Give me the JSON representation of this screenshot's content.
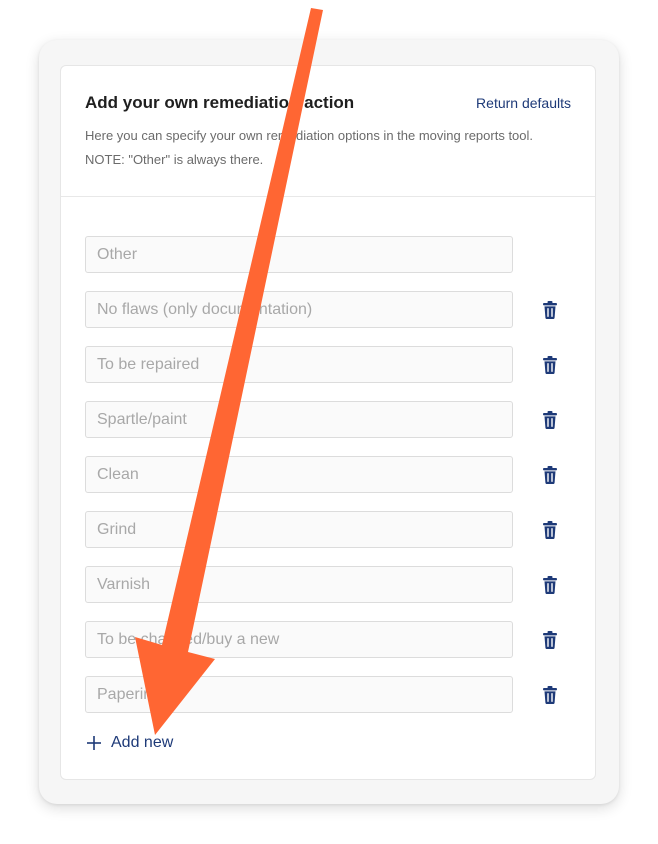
{
  "panel": {
    "title": "Add your own remediation action",
    "return_defaults_label": "Return defaults",
    "description": "Here you can specify your own remediation options in the moving reports tool. NOTE: \"Other\" is always there."
  },
  "items": [
    {
      "value": "Other",
      "deletable": false
    },
    {
      "value": "No flaws (only documentation)",
      "deletable": true
    },
    {
      "value": "To be repaired",
      "deletable": true
    },
    {
      "value": "Spartle/paint",
      "deletable": true
    },
    {
      "value": "Clean",
      "deletable": true
    },
    {
      "value": "Grind",
      "deletable": true
    },
    {
      "value": "Varnish",
      "deletable": true
    },
    {
      "value": "To be changed/buy a new",
      "deletable": true
    },
    {
      "value": "Papering",
      "deletable": true
    }
  ],
  "add_new_label": "Add new",
  "icons": {
    "delete": "trash-icon",
    "add": "plus-icon"
  },
  "colors": {
    "accent": "#1e3a78",
    "annotation_arrow": "#ff6633"
  }
}
